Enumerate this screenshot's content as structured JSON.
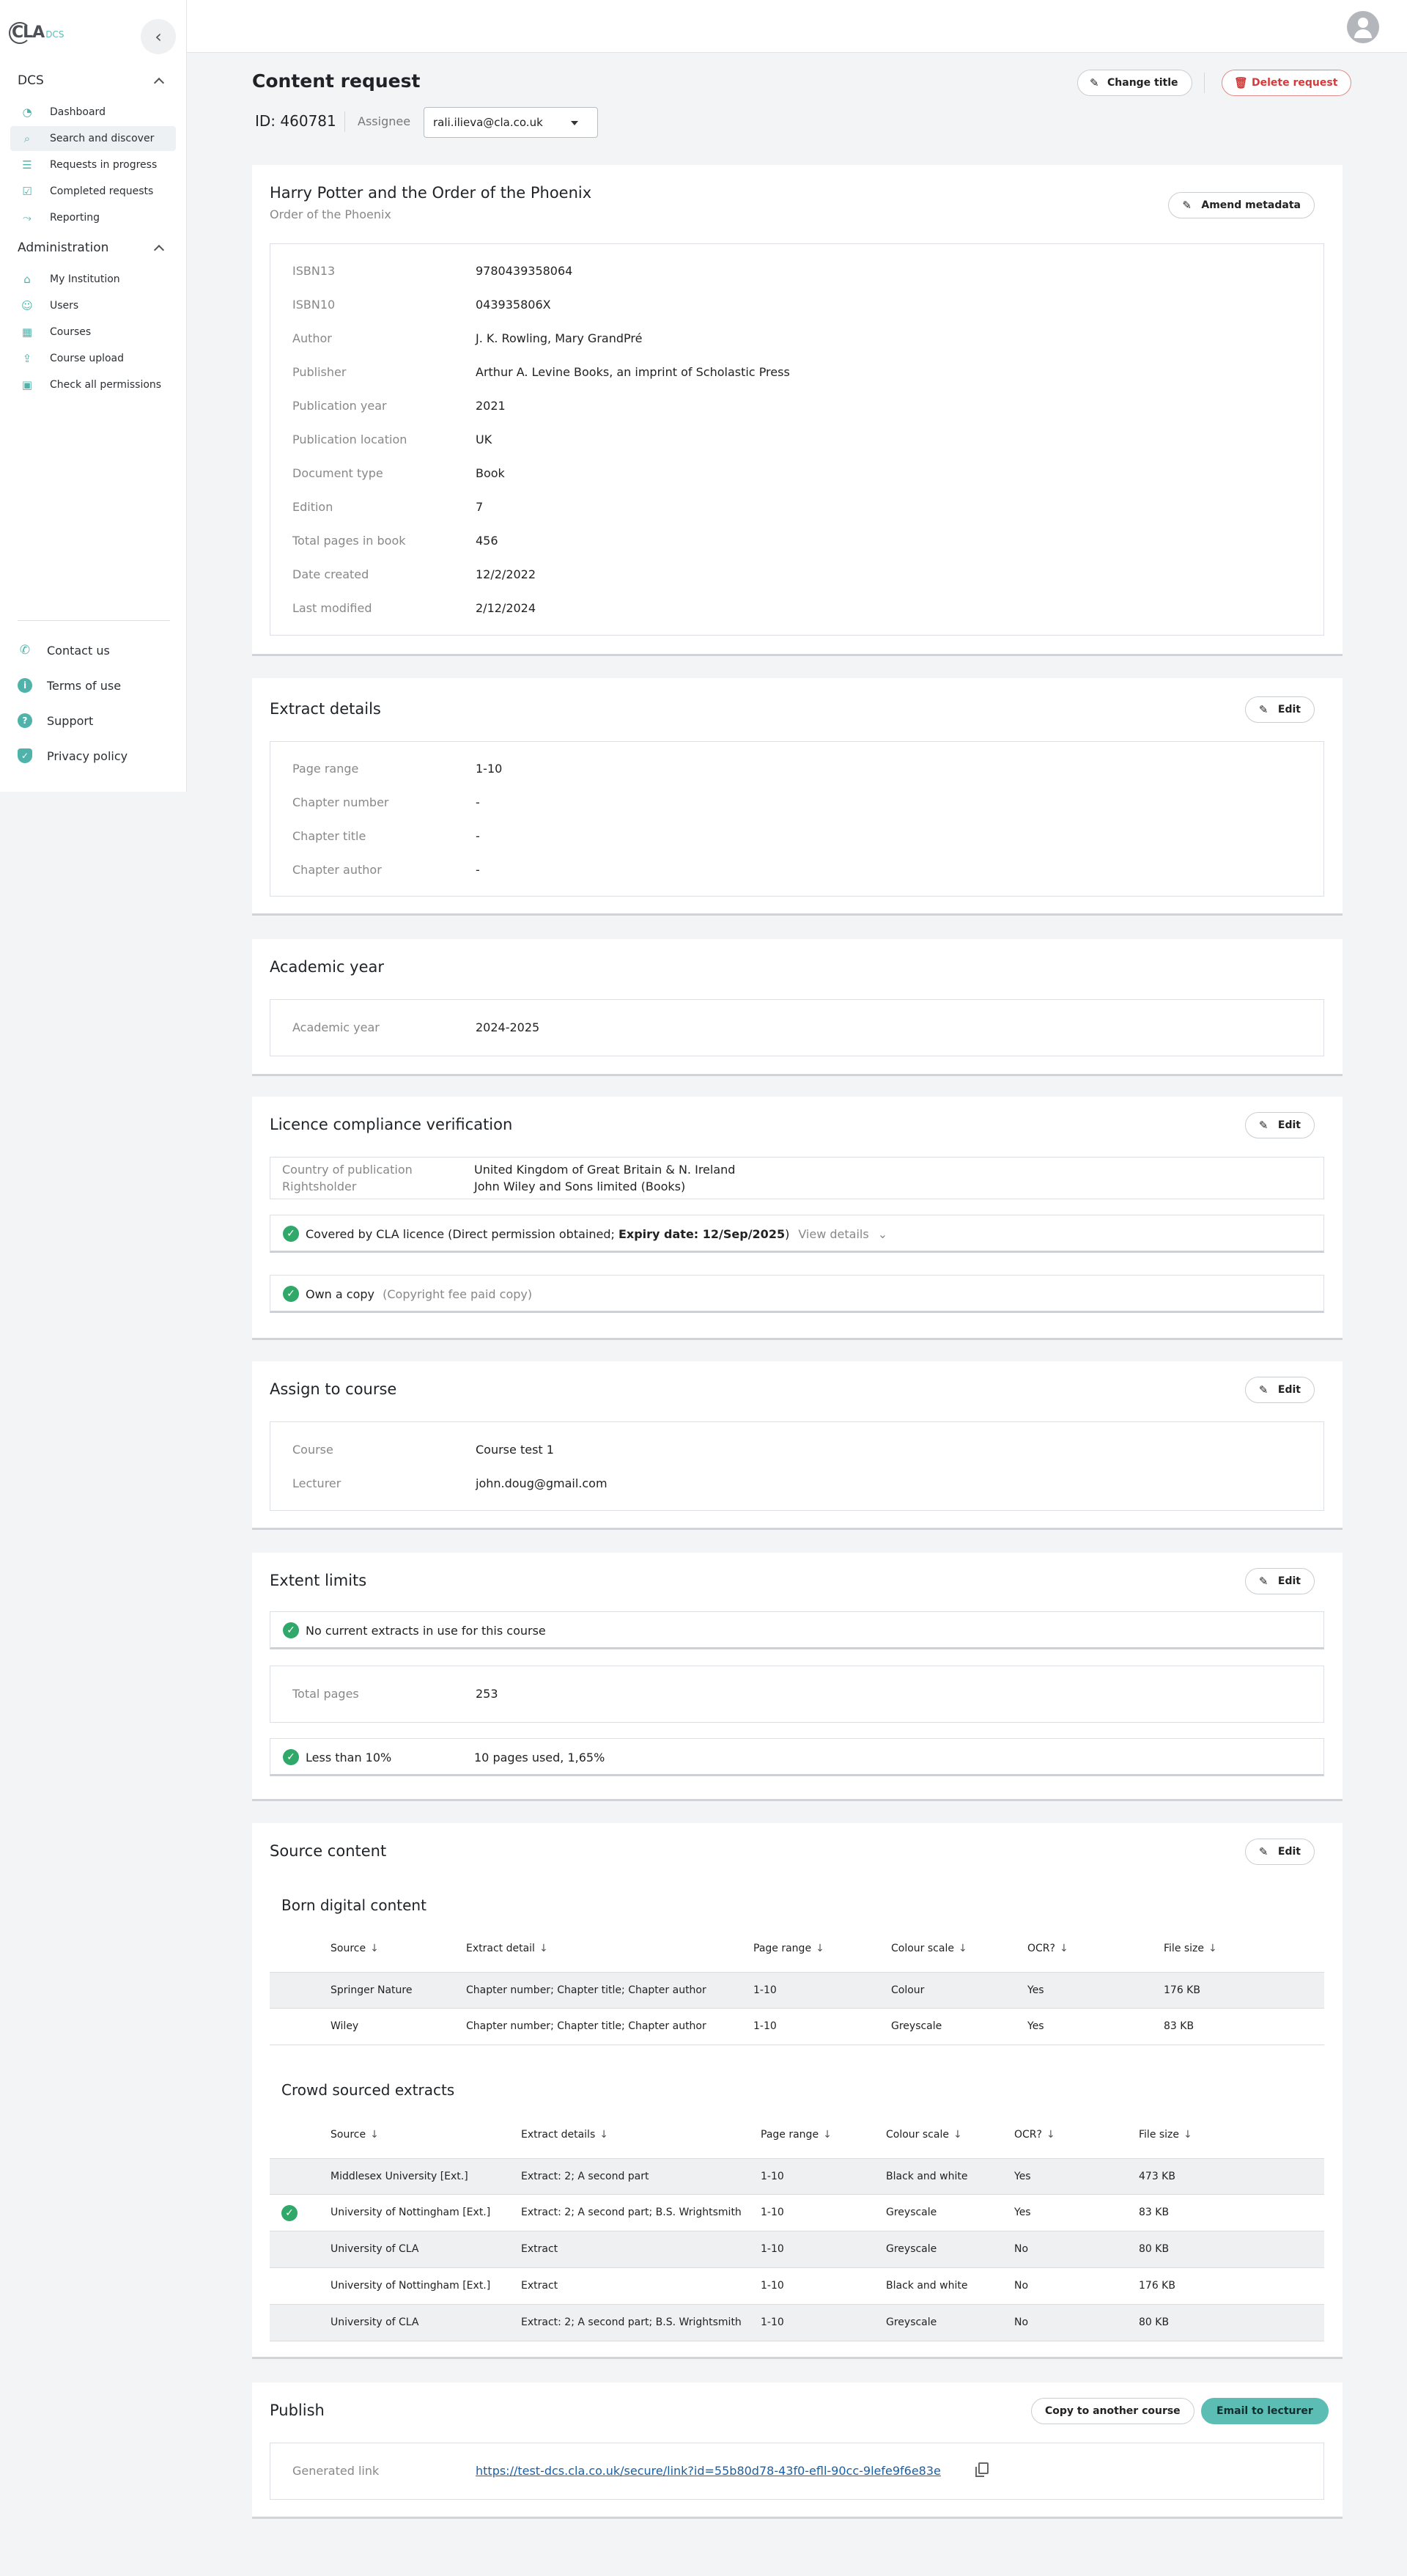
{
  "sidebar": {
    "logo": "CLA",
    "logo_sub": "DCS",
    "sections": [
      {
        "label": "DCS",
        "items": [
          {
            "label": "Dashboard",
            "icon": "dashboard-icon"
          },
          {
            "label": "Search and discover",
            "icon": "search-icon"
          },
          {
            "label": "Requests in progress",
            "icon": "list-icon"
          },
          {
            "label": "Completed requests",
            "icon": "check-square-icon"
          },
          {
            "label": "Reporting",
            "icon": "trend-icon"
          }
        ]
      },
      {
        "label": "Administration",
        "items": [
          {
            "label": "My Institution",
            "icon": "institution-icon"
          },
          {
            "label": "Users",
            "icon": "users-icon"
          },
          {
            "label": "Courses",
            "icon": "courses-icon"
          },
          {
            "label": "Course upload",
            "icon": "upload-icon"
          },
          {
            "label": "Check all permissions",
            "icon": "permissions-icon"
          }
        ]
      }
    ],
    "footer": [
      {
        "label": "Contact us",
        "icon": "phone-icon"
      },
      {
        "label": "Terms of use",
        "icon": "info-icon"
      },
      {
        "label": "Support",
        "icon": "help-icon"
      },
      {
        "label": "Privacy policy",
        "icon": "shield-icon"
      }
    ]
  },
  "header": {
    "title": "Content request",
    "change_title": "Change title",
    "delete_request": "Delete request",
    "id_text": "ID: 460781",
    "assignee_label": "Assignee",
    "assignee_value": "rali.ilieva@cla.co.uk"
  },
  "book": {
    "title": "Harry Potter and the Order of the Phoenix",
    "subtitle": "Order of the Phoenix",
    "amend_label": "Amend metadata",
    "fields": [
      {
        "label": "ISBN13",
        "value": "9780439358064"
      },
      {
        "label": "ISBN10",
        "value": "043935806X"
      },
      {
        "label": "Author",
        "value": "J. K. Rowling, Mary GrandPré"
      },
      {
        "label": "Publisher",
        "value": "Arthur A. Levine Books, an imprint of Scholastic Press"
      },
      {
        "label": "Publication year",
        "value": "2021"
      },
      {
        "label": "Publication location",
        "value": "UK"
      },
      {
        "label": "Document type",
        "value": "Book"
      },
      {
        "label": "Edition",
        "value": "7"
      },
      {
        "label": "Total pages in book",
        "value": "456"
      },
      {
        "label": "Date created",
        "value": "12/2/2022"
      },
      {
        "label": "Last modified",
        "value": "2/12/2024"
      }
    ]
  },
  "extract": {
    "title": "Extract details",
    "edit_label": "Edit",
    "fields": [
      {
        "label": "Page range",
        "value": "1-10"
      },
      {
        "label": "Chapter number",
        "value": "-"
      },
      {
        "label": "Chapter title",
        "value": "-"
      },
      {
        "label": "Chapter author",
        "value": "-"
      }
    ]
  },
  "academic": {
    "title": "Academic year",
    "label": "Academic year",
    "value": "2024-2025"
  },
  "licence": {
    "title": "Licence compliance verification",
    "edit_label": "Edit",
    "country_label": "Country of publication",
    "country_value": "United Kingdom of Great Britain & N. Ireland",
    "rightsholder_label": "Rightsholder",
    "rightsholder_value": "John Wiley and Sons limited (Books)",
    "covered_text": "Covered by CLA licence (Direct permission obtained;",
    "expiry_text": "Expiry date: 12/Sep/2025",
    "covered_close": ")",
    "view_details": "View details",
    "own_copy": "Own a copy",
    "own_copy_note": "(Copyright fee paid copy)"
  },
  "course": {
    "title": "Assign to course",
    "edit_label": "Edit",
    "course_label": "Course",
    "course_value": "Course test 1",
    "lecturer_label": "Lecturer",
    "lecturer_value": "john.doug@gmail.com"
  },
  "extent": {
    "title": "Extent limits",
    "edit_label": "Edit",
    "no_extracts": "No current extracts in use for this course",
    "total_label": "Total pages",
    "total_value": "253",
    "limit_label": "Less than 10%",
    "limit_value": "10 pages used, 1,65%"
  },
  "source": {
    "title": "Source content",
    "edit_label": "Edit",
    "born_title": "Born digital content",
    "born_headers": [
      "Source",
      "Extract detail",
      "Page range",
      "Colour scale",
      "OCR?",
      "File size"
    ],
    "born_rows": [
      [
        "Springer Nature",
        "Chapter number; Chapter title; Chapter author",
        "1-10",
        "Colour",
        "Yes",
        "176 KB"
      ],
      [
        "Wiley",
        "Chapter number; Chapter title; Chapter author",
        "1-10",
        "Greyscale",
        "Yes",
        "83 KB"
      ]
    ],
    "crowd_title": "Crowd sourced extracts",
    "crowd_headers": [
      "Source",
      "Extract details",
      "Page range",
      "Colour scale",
      "OCR?",
      "File size"
    ],
    "crowd_rows": [
      [
        "Middlesex University [Ext.]",
        "Extract: 2; A second part",
        "1-10",
        "Black and white",
        "Yes",
        "473 KB"
      ],
      [
        "University of Nottingham [Ext.]",
        "Extract: 2; A second part; B.S. Wrightsmith",
        "1-10",
        "Greyscale",
        "Yes",
        "83 KB"
      ],
      [
        "University of CLA",
        "Extract",
        "1-10",
        "Greyscale",
        "No",
        "80 KB"
      ],
      [
        "University of Nottingham [Ext.]",
        "Extract",
        "1-10",
        "Black and white",
        "No",
        "176 KB"
      ],
      [
        "University of CLA",
        "Extract: 2; A second part; B.S. Wrightsmith",
        "1-10",
        "Greyscale",
        "No",
        "80 KB"
      ]
    ]
  },
  "publish": {
    "title": "Publish",
    "copy_label": "Copy to another course",
    "email_label": "Email to lecturer",
    "link_label": "Generated link",
    "link_value": "https://test-dcs.cla.co.uk/secure/link?id=55b80d78-43f0-efll-90cc-9lefe9f6e83e"
  },
  "colors": {
    "accent": "#5cbdb5",
    "danger": "#d43a3a",
    "success": "#2fa86a"
  }
}
